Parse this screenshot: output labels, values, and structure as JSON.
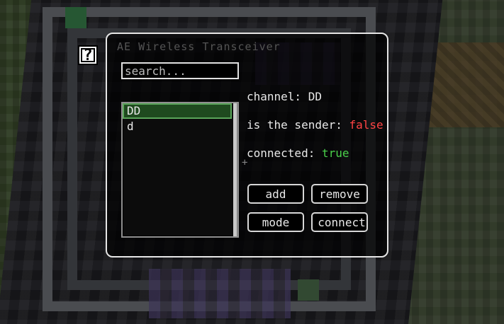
{
  "window": {
    "title": "AE Wireless Transceiver",
    "help_icon": "?"
  },
  "search": {
    "placeholder": "search..."
  },
  "channel_list": {
    "items": [
      {
        "label": "DD",
        "selected": true
      },
      {
        "label": "d",
        "selected": false
      }
    ]
  },
  "info": {
    "channel_label": "channel: ",
    "channel_value": "DD",
    "sender_label": "is the sender: ",
    "sender_value": "false",
    "connected_label": "connected: ",
    "connected_value": "true"
  },
  "buttons": {
    "add": "add",
    "remove": "remove",
    "mode": "mode",
    "connect": "connect"
  },
  "colors": {
    "false_color": "#ff4444",
    "true_color": "#4ad04a",
    "selected_bg": "#1f4a1f"
  }
}
